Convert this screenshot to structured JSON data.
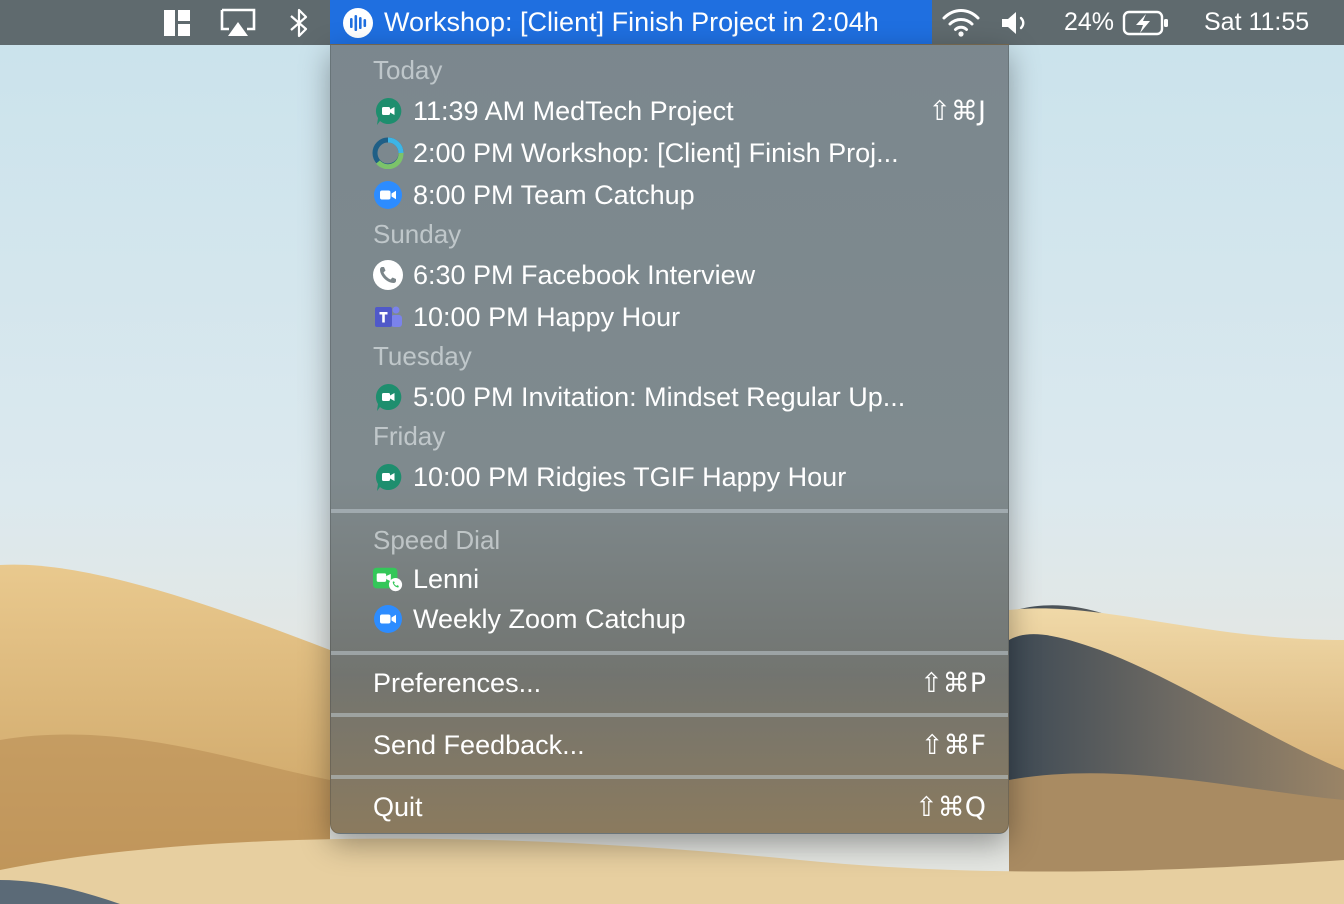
{
  "menubar": {
    "app_title": "Workshop: [Client] Finish Project in 2:04h",
    "battery_percent": "24%",
    "clock": "Sat 11:55",
    "icons": [
      "window-layout-icon",
      "airplay-icon",
      "bluetooth-icon",
      "meeting-bar-icon",
      "wifi-icon",
      "volume-icon",
      "battery-icon"
    ]
  },
  "menu": {
    "sections": {
      "today": "Today",
      "sunday": "Sunday",
      "tuesday": "Tuesday",
      "friday": "Friday",
      "speed_dial": "Speed Dial"
    },
    "events": [
      {
        "label": "11:39 AM MedTech Project",
        "shortcut": "⇧⌘J",
        "icon": "google-meet-icon"
      },
      {
        "label": "2:00 PM Workshop: [Client] Finish Proj...",
        "icon": "progress-ring-icon"
      },
      {
        "label": "8:00 PM Team Catchup",
        "icon": "zoom-icon"
      },
      {
        "label": "6:30 PM Facebook Interview",
        "icon": "phone-icon"
      },
      {
        "label": "10:00 PM Happy Hour",
        "icon": "teams-icon"
      },
      {
        "label": "5:00 PM Invitation: Mindset Regular Up...",
        "icon": "google-meet-icon"
      },
      {
        "label": "10:00 PM Ridgies TGIF Happy Hour",
        "icon": "google-meet-icon"
      }
    ],
    "speed_dial": [
      {
        "label": "Lenni",
        "icon": "facetime-icon"
      },
      {
        "label": "Weekly Zoom Catchup",
        "icon": "zoom-icon"
      }
    ],
    "preferences": {
      "label": "Preferences...",
      "shortcut": "⇧⌘P"
    },
    "feedback": {
      "label": "Send Feedback...",
      "shortcut": "⇧⌘F"
    },
    "quit": {
      "label": "Quit",
      "shortcut": "⇧⌘Q"
    }
  },
  "colors": {
    "menubar_bg": "#5f6a6e",
    "active_highlight": "#1f6fe0",
    "meet_green": "#1e8e6e",
    "zoom_blue": "#2d8cff",
    "teams_purple": "#5059c9",
    "facetime_green": "#34c759"
  }
}
